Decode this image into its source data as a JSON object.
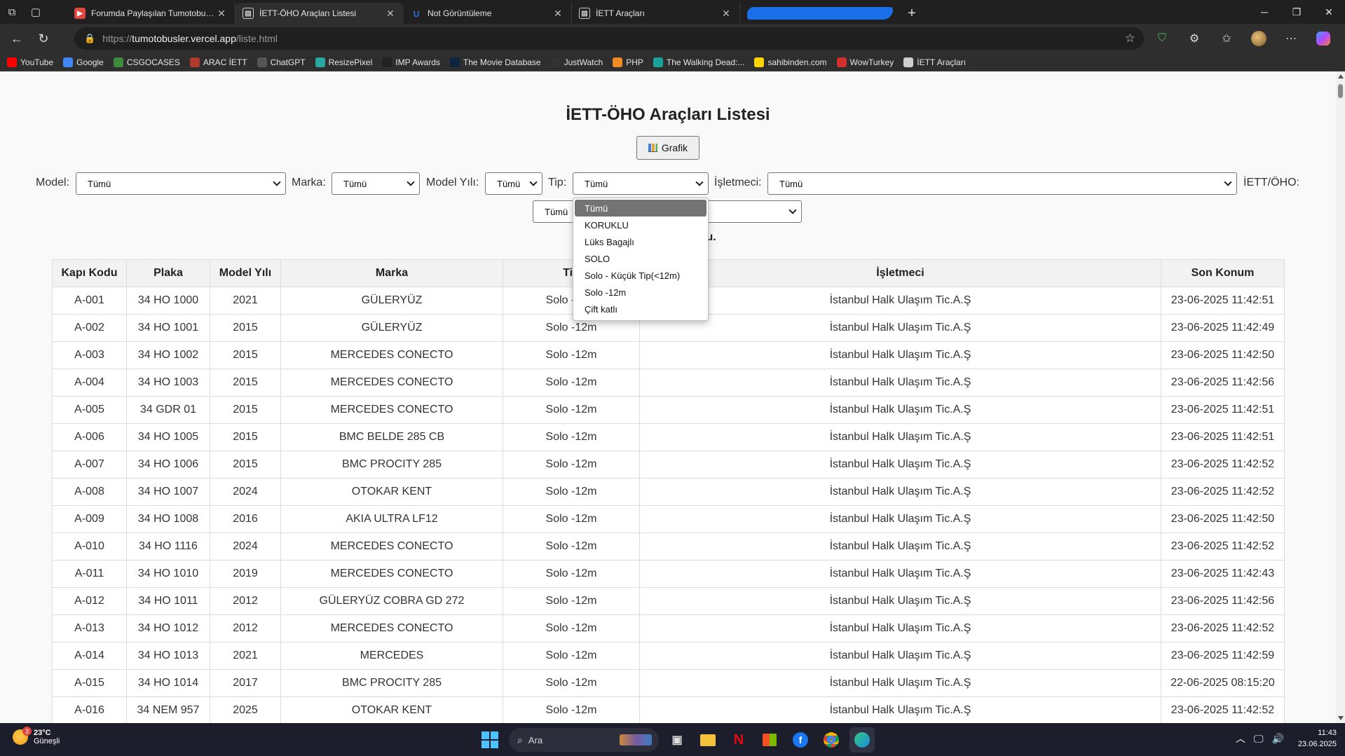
{
  "tabs": [
    {
      "title": "Forumda Paylaşılan Tumotobusler",
      "favicon_color": "#e0463c",
      "active": false
    },
    {
      "title": "İETT-ÖHO Araçları Listesi",
      "favicon_color": "#cfcfcf",
      "active": true
    },
    {
      "title": "Not Görüntüleme",
      "favicon_color": "#2d6be0",
      "active": false
    },
    {
      "title": "İETT Araçları",
      "favicon_color": "#cfcfcf",
      "active": false
    }
  ],
  "address": {
    "prefix": "https://",
    "host": "tumotobusler.vercel.app",
    "path": "/liste.html"
  },
  "bookmarks": [
    {
      "label": "YouTube",
      "color": "#ff0000"
    },
    {
      "label": "Google",
      "color": "#4285f4"
    },
    {
      "label": "CSGOCASES",
      "color": "#3c8c3c"
    },
    {
      "label": "ARAC İETT",
      "color": "#b03a2e"
    },
    {
      "label": "ChatGPT",
      "color": "#555555"
    },
    {
      "label": "ResizePixel",
      "color": "#2aa7a1"
    },
    {
      "label": "IMP Awards",
      "color": "#222222"
    },
    {
      "label": "The Movie Database",
      "color": "#0d253f"
    },
    {
      "label": "JustWatch",
      "color": "#333333"
    },
    {
      "label": "PHP",
      "color": "#f08a24"
    },
    {
      "label": "The Walking Dead:...",
      "color": "#1aa39a"
    },
    {
      "label": "sahibinden.com",
      "color": "#ffd400"
    },
    {
      "label": "WowTurkey",
      "color": "#d0312d"
    },
    {
      "label": "İETT Araçları",
      "color": "#cfcfcf"
    }
  ],
  "page": {
    "title": "İETT-ÖHO Araçları Listesi",
    "grafik_label": "Grafik",
    "info_fragment": "lu."
  },
  "filters": {
    "model_label": "Model:",
    "model_value": "Tümü",
    "marka_label": "Marka:",
    "marka_value": "Tümü",
    "yil_label": "Model Yılı:",
    "yil_value": "Tümü",
    "tip_label": "Tip:",
    "tip_value": "Tümü",
    "isletmeci_label": "İşletmeci:",
    "isletmeci_value": "Tümü",
    "iett_label": "İETT/ÖHO:",
    "iett_value": "Tümü"
  },
  "tip_dropdown": {
    "selected": "Tümü",
    "options": [
      "Tümü",
      "KORUKLU",
      "Lüks Bagajlı",
      "SOLO",
      "Solo - Küçük Tip(<12m)",
      "Solo -12m",
      "Çift katlı"
    ]
  },
  "table": {
    "columns": [
      "Kapı Kodu",
      "Plaka",
      "Model Yılı",
      "Marka",
      "Tip",
      "İşletmeci",
      "Son Konum"
    ],
    "rows": [
      [
        "A-001",
        "34 HO 1000",
        "2021",
        "GÜLERYÜZ",
        "Solo -12m",
        "İstanbul Halk Ulaşım Tic.A.Ş",
        "23-06-2025 11:42:51"
      ],
      [
        "A-002",
        "34 HO 1001",
        "2015",
        "GÜLERYÜZ",
        "Solo -12m",
        "İstanbul Halk Ulaşım Tic.A.Ş",
        "23-06-2025 11:42:49"
      ],
      [
        "A-003",
        "34 HO 1002",
        "2015",
        "MERCEDES CONECTO",
        "Solo -12m",
        "İstanbul Halk Ulaşım Tic.A.Ş",
        "23-06-2025 11:42:50"
      ],
      [
        "A-004",
        "34 HO 1003",
        "2015",
        "MERCEDES CONECTO",
        "Solo -12m",
        "İstanbul Halk Ulaşım Tic.A.Ş",
        "23-06-2025 11:42:56"
      ],
      [
        "A-005",
        "34 GDR 01",
        "2015",
        "MERCEDES CONECTO",
        "Solo -12m",
        "İstanbul Halk Ulaşım Tic.A.Ş",
        "23-06-2025 11:42:51"
      ],
      [
        "A-006",
        "34 HO 1005",
        "2015",
        "BMC BELDE 285 CB",
        "Solo -12m",
        "İstanbul Halk Ulaşım Tic.A.Ş",
        "23-06-2025 11:42:51"
      ],
      [
        "A-007",
        "34 HO 1006",
        "2015",
        "BMC PROCITY 285",
        "Solo -12m",
        "İstanbul Halk Ulaşım Tic.A.Ş",
        "23-06-2025 11:42:52"
      ],
      [
        "A-008",
        "34 HO 1007",
        "2024",
        "OTOKAR KENT",
        "Solo -12m",
        "İstanbul Halk Ulaşım Tic.A.Ş",
        "23-06-2025 11:42:52"
      ],
      [
        "A-009",
        "34 HO 1008",
        "2016",
        "AKIA ULTRA LF12",
        "Solo -12m",
        "İstanbul Halk Ulaşım Tic.A.Ş",
        "23-06-2025 11:42:50"
      ],
      [
        "A-010",
        "34 HO 1116",
        "2024",
        "MERCEDES CONECTO",
        "Solo -12m",
        "İstanbul Halk Ulaşım Tic.A.Ş",
        "23-06-2025 11:42:52"
      ],
      [
        "A-011",
        "34 HO 1010",
        "2019",
        "MERCEDES CONECTO",
        "Solo -12m",
        "İstanbul Halk Ulaşım Tic.A.Ş",
        "23-06-2025 11:42:43"
      ],
      [
        "A-012",
        "34 HO 1011",
        "2012",
        "GÜLERYÜZ COBRA GD 272",
        "Solo -12m",
        "İstanbul Halk Ulaşım Tic.A.Ş",
        "23-06-2025 11:42:56"
      ],
      [
        "A-013",
        "34 HO 1012",
        "2012",
        "MERCEDES CONECTO",
        "Solo -12m",
        "İstanbul Halk Ulaşım Tic.A.Ş",
        "23-06-2025 11:42:52"
      ],
      [
        "A-014",
        "34 HO 1013",
        "2021",
        "MERCEDES",
        "Solo -12m",
        "İstanbul Halk Ulaşım Tic.A.Ş",
        "23-06-2025 11:42:59"
      ],
      [
        "A-015",
        "34 HO 1014",
        "2017",
        "BMC PROCITY 285",
        "Solo -12m",
        "İstanbul Halk Ulaşım Tic.A.Ş",
        "22-06-2025 08:15:20"
      ],
      [
        "A-016",
        "34 NEM 957",
        "2025",
        "OTOKAR KENT",
        "Solo -12m",
        "İstanbul Halk Ulaşım Tic.A.Ş",
        "23-06-2025 11:42:52"
      ]
    ]
  },
  "taskbar": {
    "weather_temp": "23°C",
    "weather_desc": "Güneşli",
    "weather_badge": "3",
    "search_placeholder": "Ara",
    "time": "11:43",
    "date": "23.06.2025"
  }
}
